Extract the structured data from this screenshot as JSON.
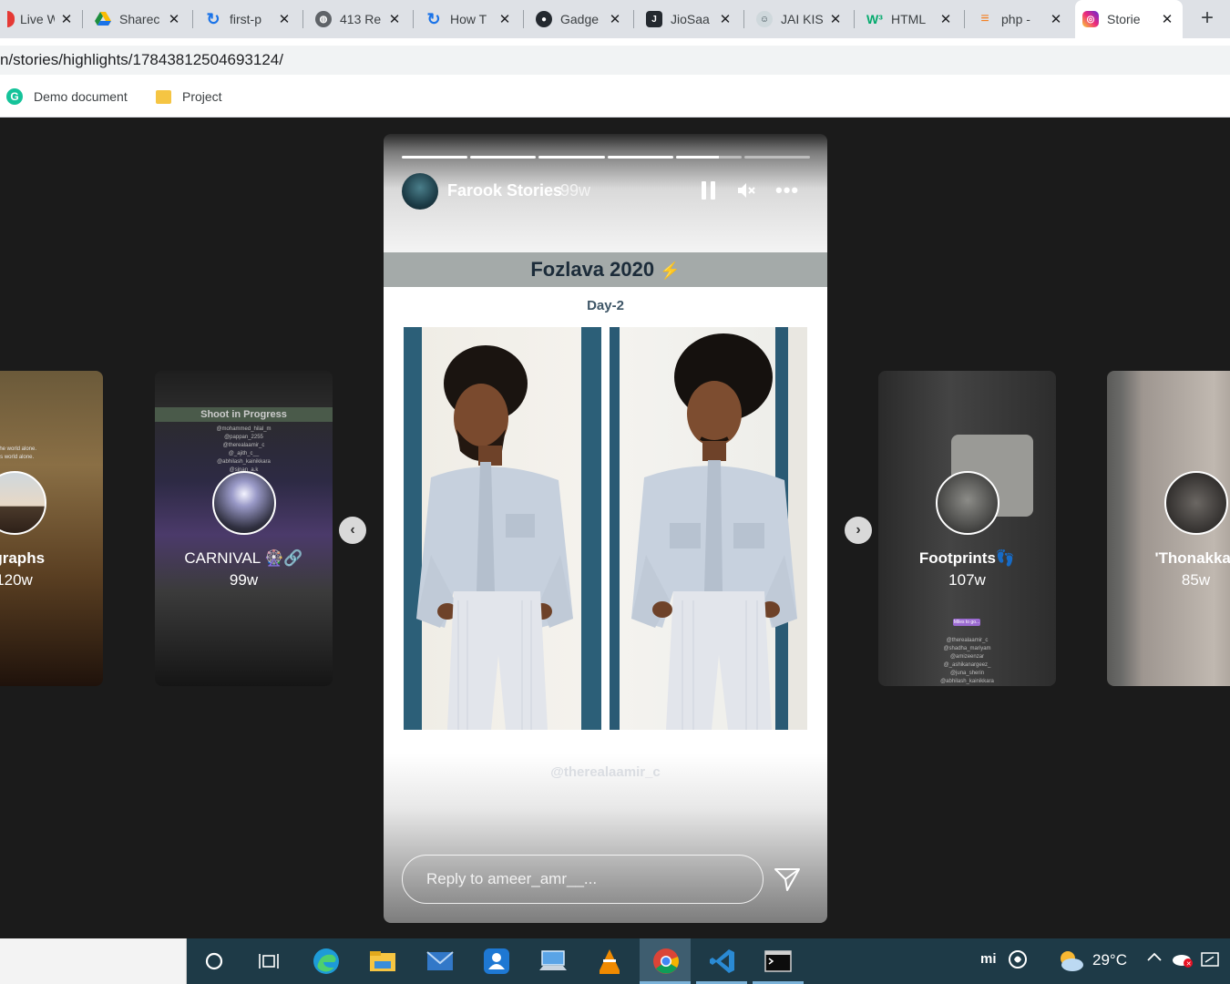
{
  "browser": {
    "tabs": [
      {
        "label": "Live W",
        "favicon": "red-dot-icon",
        "color": "#e53935"
      },
      {
        "label": "Sharec",
        "favicon": "google-drive-icon",
        "color": "#1e8e3e"
      },
      {
        "label": "first-p",
        "favicon": "sync-icon",
        "color": "#1a73e8"
      },
      {
        "label": "413 Re",
        "favicon": "globe-icon",
        "color": "#5f6368"
      },
      {
        "label": "How T",
        "favicon": "sync-icon",
        "color": "#1a73e8"
      },
      {
        "label": "Gadge",
        "favicon": "github-icon",
        "color": "#24292f"
      },
      {
        "label": "JioSaa",
        "favicon": "jiosaavn-icon",
        "color": "#24292f"
      },
      {
        "label": "JAI KIS",
        "favicon": "avatar-icon",
        "color": "#5f6368"
      },
      {
        "label": "HTML",
        "favicon": "w3schools-icon",
        "color": "#04aa6d"
      },
      {
        "label": "php -",
        "favicon": "stackoverflow-icon",
        "color": "#f48024"
      },
      {
        "label": "Storie",
        "favicon": "instagram-icon",
        "color": "#d62976",
        "active": true
      }
    ],
    "url": "n/stories/highlights/17843812504693124/",
    "bookmarks": [
      {
        "label": "Demo document",
        "icon": "grammarly-icon"
      },
      {
        "label": "Project",
        "icon": "folder-icon"
      }
    ]
  },
  "stories": {
    "left_far": {
      "title": "ographs",
      "age": "120w"
    },
    "left": {
      "title": "CARNIVAL 🎡🔗",
      "age": "99w",
      "banner": "Shoot in Progress"
    },
    "right": {
      "title": "Footprints👣",
      "age": "107w",
      "badge": "Miles to go..."
    },
    "right_far": {
      "title": "'Thonakkar",
      "age": "85w"
    }
  },
  "story": {
    "username": "Farook Stories",
    "age": "99w",
    "progress": [
      1,
      1,
      1,
      1,
      0.65,
      0
    ],
    "content_title": "Fozlava 2020",
    "content_emoji": "⚡",
    "content_day": "Day-2",
    "content_handle": "@therealaamir_c",
    "reply_placeholder": "Reply to ameer_amr__..."
  },
  "taskbar": {
    "weather": "29°C",
    "apps": [
      "start-icon",
      "task-view-icon",
      "edge-icon",
      "file-explorer-icon",
      "mail-icon",
      "store-icon",
      "pc-icon",
      "vlc-icon",
      "chrome-icon",
      "vscode-icon",
      "terminal-icon"
    ]
  }
}
